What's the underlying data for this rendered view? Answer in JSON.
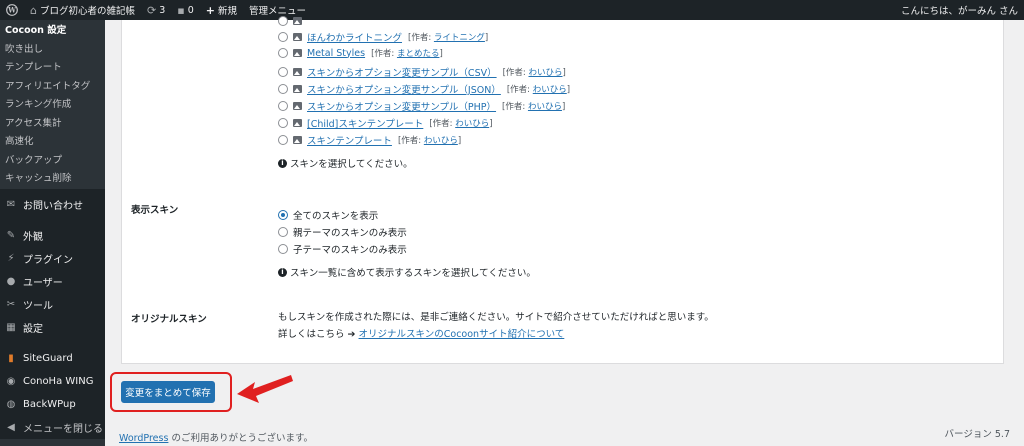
{
  "adminbar": {
    "site_name": "ブログ初心者の雑記帳",
    "updates": "3",
    "comments": "0",
    "new": "新規",
    "admin_menu": "管理メニュー",
    "greeting": "こんにちは、がーみん さん"
  },
  "sidebar": {
    "submenu": [
      {
        "label": "Cocoon 設定"
      },
      {
        "label": "吹き出し"
      },
      {
        "label": "テンプレート"
      },
      {
        "label": "アフィリエイトタグ"
      },
      {
        "label": "ランキング作成"
      },
      {
        "label": "アクセス集計"
      },
      {
        "label": "高速化"
      },
      {
        "label": "バックアップ"
      },
      {
        "label": "キャッシュ削除"
      }
    ],
    "menu": [
      {
        "label": "お問い合わせ",
        "icon": "envelope-icon"
      },
      {
        "label": "外観",
        "icon": "paintbrush-icon"
      },
      {
        "label": "プラグイン",
        "icon": "plugin-icon"
      },
      {
        "label": "ユーザー",
        "icon": "user-icon"
      },
      {
        "label": "ツール",
        "icon": "wrench-icon"
      },
      {
        "label": "設定",
        "icon": "settings-icon"
      },
      {
        "label": "SiteGuard",
        "icon": "siteguard-icon"
      },
      {
        "label": "ConoHa WING",
        "icon": "conoha-icon"
      },
      {
        "label": "BackWPup",
        "icon": "backwpup-icon"
      },
      {
        "label": "メニューを閉じる",
        "icon": "collapse-icon"
      }
    ]
  },
  "skins": {
    "list": [
      {
        "name": "ほんわかライトニング",
        "author_label": "[作者:",
        "author": "ライトニング",
        "close": "]"
      },
      {
        "name": "Metal Styles",
        "author_label": "[作者:",
        "author": "まとめたる",
        "close": "]"
      },
      {
        "name": "スキンからオプション変更サンプル（CSV）",
        "author_label": "[作者:",
        "author": "わいひら",
        "close": "]"
      },
      {
        "name": "スキンからオプション変更サンプル（JSON）",
        "author_label": "[作者:",
        "author": "わいひら",
        "close": "]"
      },
      {
        "name": "スキンからオプション変更サンプル（PHP）",
        "author_label": "[作者:",
        "author": "わいひら",
        "close": "]"
      },
      {
        "name": "[Child]スキンテンプレート",
        "author_label": "[作者:",
        "author": "わいひら",
        "close": "]"
      },
      {
        "name": "スキンテンプレート",
        "author_label": "[作者:",
        "author": "わいひら",
        "close": "]"
      }
    ],
    "note": "スキンを選択してください。"
  },
  "display_skin": {
    "label": "表示スキン",
    "options": [
      {
        "label": "全てのスキンを表示",
        "checked": true
      },
      {
        "label": "親テーマのスキンのみ表示",
        "checked": false
      },
      {
        "label": "子テーマのスキンのみ表示",
        "checked": false
      }
    ],
    "note": "スキン一覧に含めて表示するスキンを選択してください。"
  },
  "original_skin": {
    "label": "オリジナルスキン",
    "text": "もしスキンを作成された際には、是非ご連絡ください。サイトで紹介させていただければと思います。",
    "more_prefix": "詳しくはこちら",
    "more_link": "オリジナルスキンのCocoonサイト紹介について"
  },
  "save_button": "変更をまとめて保存",
  "footer": {
    "wp_link": "WordPress",
    "thanks": " のご利用ありがとうございます。",
    "version": "バージョン 5.7"
  },
  "colors": {
    "accent": "#2271b1",
    "highlight": "#e02020"
  }
}
